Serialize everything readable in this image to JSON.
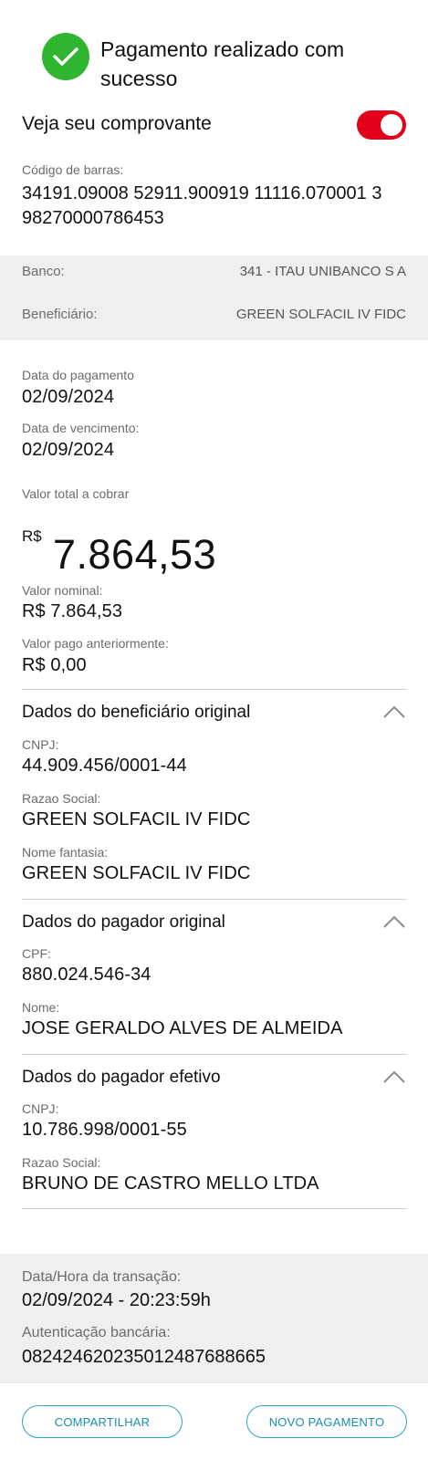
{
  "header": {
    "success_title": "Pagamento realizado com sucesso",
    "success_icon": "check-circle-icon",
    "success_color": "#2fb52f"
  },
  "receipt_toggle": {
    "label": "Veja seu comprovante",
    "state": "on",
    "color": "#e3001a"
  },
  "barcode": {
    "label": "Código de barras:",
    "value": "34191.09008 52911.900919 11116.070001 3 98270000786453"
  },
  "bank_info": {
    "bank_label": "Banco:",
    "bank_value": "341 - ITAU UNIBANCO S A",
    "beneficiary_label": "Beneficiário:",
    "beneficiary_value": "GREEN SOLFACIL IV FIDC"
  },
  "dates": {
    "payment_label": "Data do pagamento",
    "payment_value": "02/09/2024",
    "due_label": "Data de vencimento:",
    "due_value": "02/09/2024"
  },
  "total": {
    "label": "Valor total a cobrar",
    "currency": "R$",
    "amount": "7.864,53"
  },
  "values": {
    "nominal_label": "Valor nominal:",
    "nominal_value": "R$ 7.864,53",
    "previous_label": "Valor pago anteriormente:",
    "previous_value": "R$ 0,00"
  },
  "original_beneficiary": {
    "title": "Dados do beneficiário original",
    "cnpj_label": "CNPJ:",
    "cnpj_value": "44.909.456/0001-44",
    "razao_label": "Razao Social:",
    "razao_value": "GREEN SOLFACIL IV FIDC",
    "fantasia_label": "Nome fantasia:",
    "fantasia_value": "GREEN SOLFACIL IV FIDC"
  },
  "original_payer": {
    "title": "Dados do pagador original",
    "cpf_label": "CPF:",
    "cpf_value": "880.024.546-34",
    "name_label": "Nome:",
    "name_value": "JOSE GERALDO ALVES DE ALMEIDA"
  },
  "effective_payer": {
    "title": "Dados do pagador efetivo",
    "cnpj_label": "CNPJ:",
    "cnpj_value": "10.786.998/0001-55",
    "razao_label": "Razao Social:",
    "razao_value": "BRUNO DE CASTRO MELLO LTDA"
  },
  "transaction": {
    "datetime_label": "Data/Hora da transação:",
    "datetime_value": "02/09/2024 - 20:23:59h",
    "auth_label": "Autenticação bancária:",
    "auth_value": "082424620235012487688665"
  },
  "actions": {
    "share_label": "COMPARTILHAR",
    "new_payment_label": "NOVO PAGAMENTO",
    "accent_color": "#2aa6c6"
  }
}
